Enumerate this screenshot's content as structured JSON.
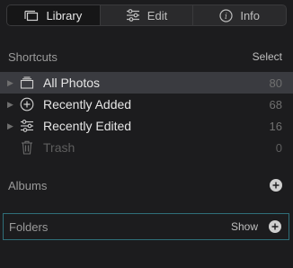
{
  "tabs": [
    {
      "label": "Library",
      "icon": "library-icon",
      "active": true
    },
    {
      "label": "Edit",
      "icon": "sliders-icon",
      "active": false
    },
    {
      "label": "Info",
      "icon": "info-icon",
      "active": false
    }
  ],
  "shortcuts": {
    "title": "Shortcuts",
    "action": "Select",
    "items": [
      {
        "label": "All Photos",
        "count": "80",
        "icon": "photos-stack-icon"
      },
      {
        "label": "Recently Added",
        "count": "68",
        "icon": "plus-circle-icon"
      },
      {
        "label": "Recently Edited",
        "count": "16",
        "icon": "sliders-icon"
      },
      {
        "label": "Trash",
        "count": "0",
        "icon": "trash-icon"
      }
    ]
  },
  "albums": {
    "title": "Albums"
  },
  "folders": {
    "title": "Folders",
    "action": "Show"
  },
  "colors": {
    "background": "#1c1c1e",
    "selected_row": "#3a3b40",
    "focus_border": "#2f6f7a"
  }
}
